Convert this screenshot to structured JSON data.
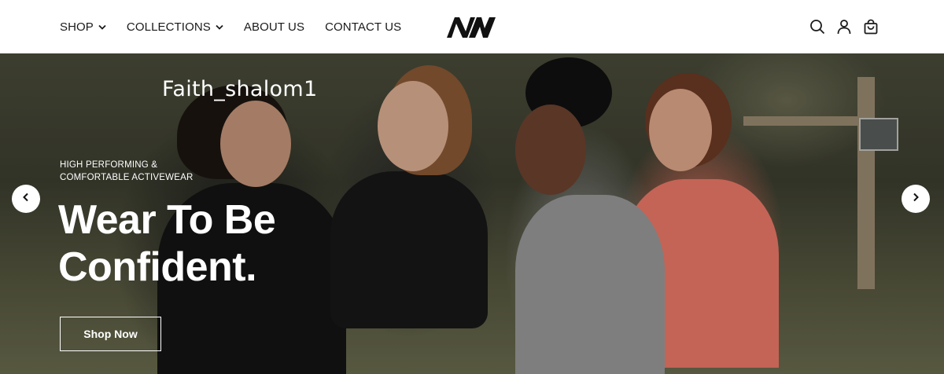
{
  "header": {
    "nav": [
      {
        "label": "SHOP",
        "dropdown": true
      },
      {
        "label": "COLLECTIONS",
        "dropdown": true
      },
      {
        "label": "ABOUT US",
        "dropdown": false
      },
      {
        "label": "CONTACT US",
        "dropdown": false
      }
    ],
    "icons": [
      "search-icon",
      "account-icon",
      "cart-icon"
    ]
  },
  "hero": {
    "watermark": "Faith_shalom1",
    "kicker_line1": "HIGH PERFORMING &",
    "kicker_line2": "COMFORTABLE ACTIVEWEAR",
    "headline_line1": "Wear To Be",
    "headline_line2": "Confident.",
    "cta_label": "Shop Now"
  },
  "colors": {
    "text_dark": "#1a1a1a",
    "hero_text": "#ffffff"
  }
}
